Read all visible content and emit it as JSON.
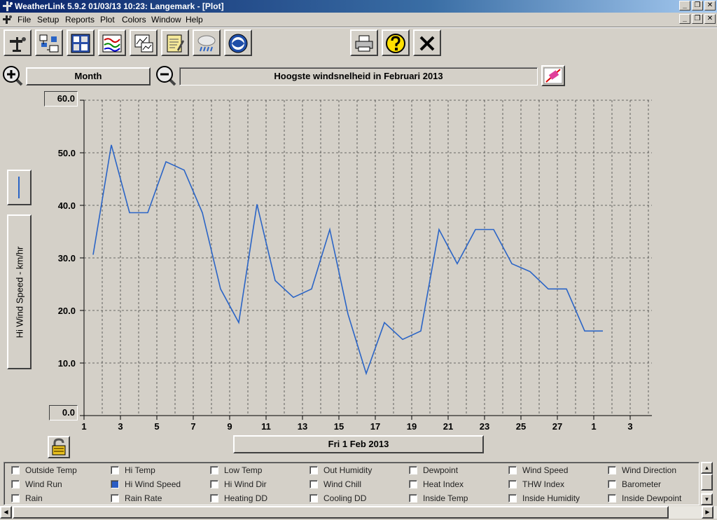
{
  "window": {
    "title": "WeatherLink 5.9.2  01/03/13  10:23: Langemark - [Plot]",
    "minimize": "_",
    "restore": "❐",
    "close": "✕"
  },
  "menu": [
    "File",
    "Setup",
    "Reports",
    "Plot",
    "Colors",
    "Window",
    "Help"
  ],
  "toolbar_icons": [
    "station-icon",
    "connect-icon",
    "bulletin-icon",
    "plot-icon",
    "browse-icon",
    "notes-icon",
    "weather-icon",
    "noaa-icon",
    "print-icon",
    "help-icon",
    "close-icon"
  ],
  "controls": {
    "period": "Month",
    "plot_title": "Hoogste windsnelheid in Februari 2013",
    "date": "Fri 1 Feb 2013",
    "ymax": "60.0",
    "ymin": "0.0",
    "ylabel": "Hi Wind Speed - km/hr"
  },
  "chart_data": {
    "type": "line",
    "xlabel": "",
    "ylabel": "Hi Wind Speed - km/hr",
    "ylim": [
      0,
      60
    ],
    "yticks": [
      "60.0",
      "50.0",
      "40.0",
      "30.0",
      "20.0",
      "10.0",
      "0.0"
    ],
    "xticks": [
      "1",
      "3",
      "5",
      "7",
      "9",
      "11",
      "13",
      "15",
      "17",
      "19",
      "21",
      "23",
      "25",
      "27",
      "1",
      "3"
    ],
    "grid": true,
    "line_color": "#2a64c6",
    "series": [
      {
        "x": [
          1.5,
          2.5,
          3.5,
          4.5,
          5.5,
          6.5,
          7.5,
          8.5,
          9.5,
          10.5,
          11.5,
          12.5,
          13.5,
          14.5,
          15.5,
          16.5,
          17.5,
          18.5,
          19.5,
          20.5,
          21.5,
          22.5,
          23.5,
          24.5,
          25.5,
          26.5,
          27.5,
          28.5,
          29.5
        ],
        "values": [
          30.6,
          51.5,
          38.6,
          38.6,
          48.3,
          46.7,
          38.6,
          24.1,
          17.7,
          40.2,
          25.7,
          22.5,
          24.1,
          35.4,
          19.3,
          8.0,
          17.7,
          14.5,
          16.1,
          35.4,
          28.9,
          35.4,
          35.4,
          28.9,
          27.4,
          24.1,
          24.1,
          16.1,
          16.1
        ]
      }
    ]
  },
  "checkboxes": [
    [
      {
        "label": "Outside Temp",
        "checked": false
      },
      {
        "label": "Hi Temp",
        "checked": false
      },
      {
        "label": "Low Temp",
        "checked": false
      },
      {
        "label": "Out Humidity",
        "checked": false
      },
      {
        "label": "Dewpoint",
        "checked": false
      },
      {
        "label": "Wind Speed",
        "checked": false
      },
      {
        "label": "Wind Direction",
        "checked": false
      }
    ],
    [
      {
        "label": "Wind Run",
        "checked": false
      },
      {
        "label": "Hi Wind Speed",
        "checked": true
      },
      {
        "label": "Hi Wind Dir",
        "checked": false
      },
      {
        "label": "Wind Chill",
        "checked": false
      },
      {
        "label": "Heat Index",
        "checked": false
      },
      {
        "label": "THW Index",
        "checked": false
      },
      {
        "label": "Barometer",
        "checked": false
      }
    ],
    [
      {
        "label": "Rain",
        "checked": false
      },
      {
        "label": "Rain Rate",
        "checked": false
      },
      {
        "label": "Heating DD",
        "checked": false
      },
      {
        "label": "Cooling DD",
        "checked": false
      },
      {
        "label": "Inside Temp",
        "checked": false
      },
      {
        "label": "Inside Humidity",
        "checked": false
      },
      {
        "label": "Inside Dewpoint",
        "checked": false
      }
    ]
  ]
}
